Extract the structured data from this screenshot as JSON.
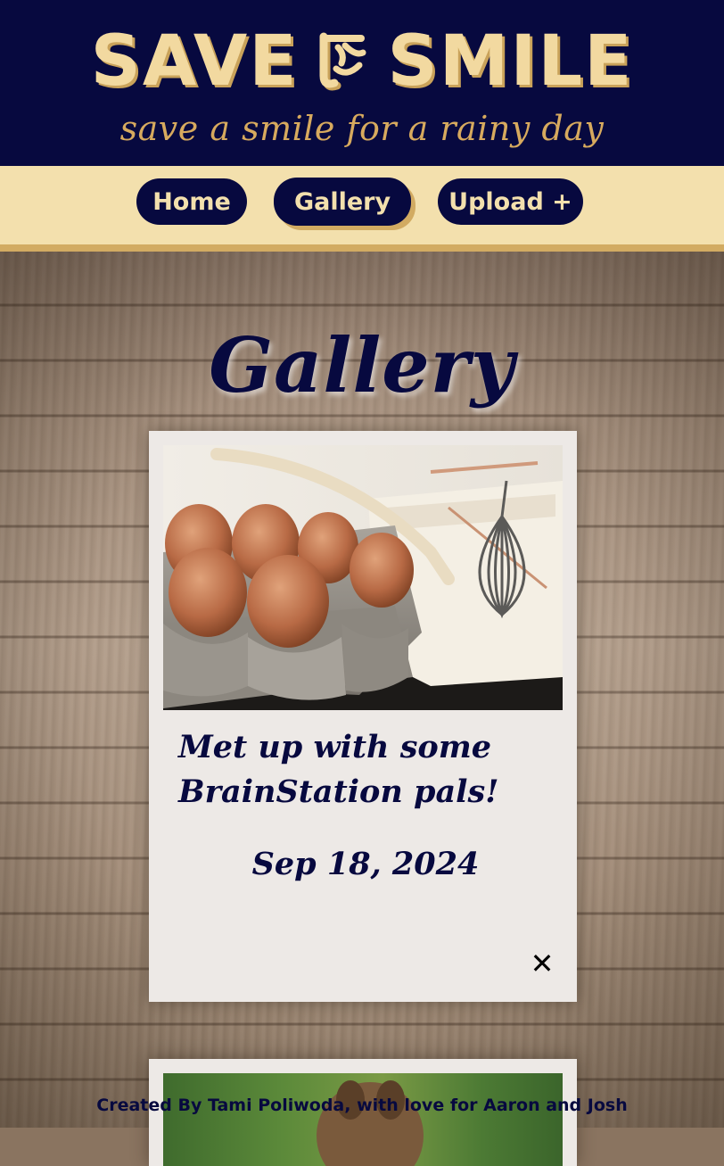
{
  "header": {
    "logo_left": "SAVE",
    "logo_right": "SMILE",
    "tagline": "save a smile for a rainy day"
  },
  "nav": {
    "items": [
      {
        "label": "Home"
      },
      {
        "label": "Gallery",
        "active": true
      },
      {
        "label": "Upload +"
      }
    ]
  },
  "main": {
    "title": "Gallery",
    "posts": [
      {
        "image": "eggs-in-carton-whisk-cookbook-photo",
        "caption": "Met up with some BrainStation pals!",
        "date": "Sep 18, 2024",
        "delete_label": "✕"
      },
      {
        "image": "animal-in-grass-photo"
      }
    ]
  },
  "footer": {
    "text": "Created By Tami Poliwoda, with love for Aaron and Josh"
  },
  "colors": {
    "navy": "#07093f",
    "cream": "#f3e0ad",
    "gold": "#d2ab62",
    "card": "#ede9e6"
  }
}
